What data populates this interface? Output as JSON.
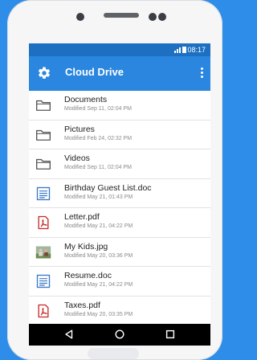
{
  "status_bar": {
    "time": "08:17"
  },
  "app_bar": {
    "title": "Cloud Drive",
    "icons": {
      "left": "gear-icon",
      "right": "more-vert-icon"
    }
  },
  "files": [
    {
      "name": "Documents",
      "meta": "Modified Sep 11, 02:04 PM",
      "icon": "folder-icon"
    },
    {
      "name": "Pictures",
      "meta": "Modified Feb 24, 02:32 PM",
      "icon": "folder-icon"
    },
    {
      "name": "Videos",
      "meta": "Modified Sep 11, 02:04 PM",
      "icon": "folder-icon"
    },
    {
      "name": "Birthday Guest List.doc",
      "meta": "Modified May 21, 01:43 PM",
      "icon": "document-icon"
    },
    {
      "name": "Letter.pdf",
      "meta": "Modified May 21, 04:22 PM",
      "icon": "pdf-icon"
    },
    {
      "name": "My Kids.jpg",
      "meta": "Modified May 20, 03:36 PM",
      "icon": "photo-thumbnail"
    },
    {
      "name": "Resume.doc",
      "meta": "Modified May 21, 04:22 PM",
      "icon": "document-icon"
    },
    {
      "name": "Taxes.pdf",
      "meta": "Modified May 20, 03:35 PM",
      "icon": "pdf-icon"
    }
  ],
  "navigation": {
    "icons": [
      "back-icon",
      "home-icon",
      "recents-icon"
    ]
  },
  "colors": {
    "background": "#2d8de8",
    "status_bar": "#1d6fc2",
    "app_bar": "#2a86de",
    "doc_icon": "#3a78c6",
    "pdf_icon": "#c62828"
  }
}
